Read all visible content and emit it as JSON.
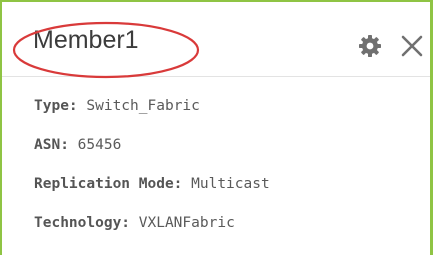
{
  "panel": {
    "title": "Member1",
    "icons": {
      "settings": "gear-icon",
      "close": "close-icon"
    },
    "colors": {
      "border": "#8fc444",
      "highlight": "#d93a3a",
      "icon": "#707070"
    }
  },
  "details": [
    {
      "key": "Type:",
      "value": "Switch_Fabric"
    },
    {
      "key": "ASN:",
      "value": "65456"
    },
    {
      "key": "Replication Mode:",
      "value": "Multicast"
    },
    {
      "key": "Technology:",
      "value": "VXLANFabric"
    }
  ]
}
